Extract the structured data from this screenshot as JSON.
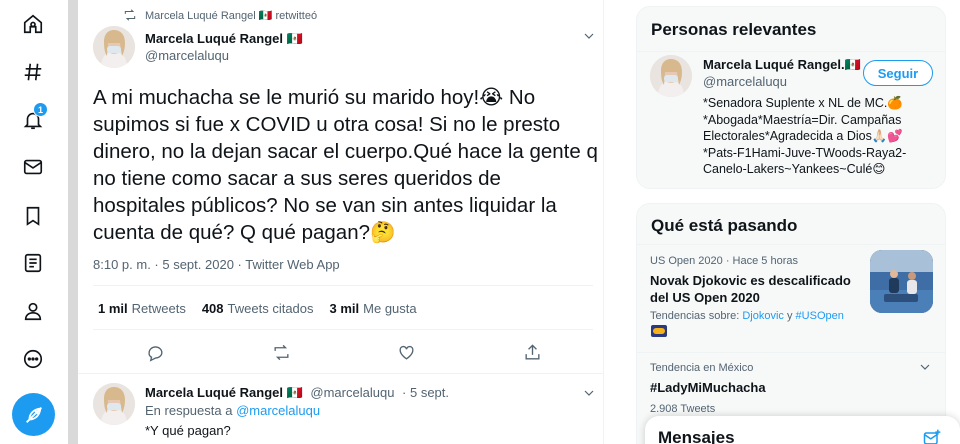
{
  "nav": {
    "items": [
      "home-icon",
      "explore-icon",
      "notifications-icon",
      "messages-icon",
      "bookmarks-icon",
      "lists-icon",
      "profile-icon",
      "more-icon"
    ],
    "notif_count": "1"
  },
  "tweet": {
    "retweeted_by": "Marcela Luqué Rangel 🇲🇽 retwitteó",
    "author_name": "Marcela Luqué Rangel 🇲🇽",
    "author_handle": "@marcelaluqu",
    "text": "A mi muchacha se le murió su marido hoy!😭 No supimos si fue x COVID u otra cosa! Si no le presto dinero, no la dejan sacar el cuerpo.Qué hace la gente q no tiene como sacar a sus seres queridos de hospitales públicos? No se van sin antes liquidar la cuenta de qué? Q qué pagan?🤔",
    "meta": "8:10 p. m. · 5 sept. 2020 · Twitter Web App",
    "retweets_count": "1 mil",
    "retweets_label": "Retweets",
    "quotes_count": "408",
    "quotes_label": "Tweets citados",
    "likes_count": "3 mil",
    "likes_label": "Me gusta"
  },
  "reply": {
    "author_name": "Marcela Luqué Rangel 🇲🇽",
    "author_handle": "@marcelaluqu",
    "time": "· 5 sept.",
    "reply_prefix": "En respuesta a",
    "reply_to": "@marcelaluqu",
    "text": "*Y qué pagan?"
  },
  "relevant": {
    "title": "Personas relevantes",
    "name": "Marcela Luqué Rangel.🇲🇽",
    "handle": "@marcelaluqu",
    "follow_label": "Seguir",
    "bio": "*Senadora Suplente x NL de MC.🍊 *Abogada*Maestría=Dir. Campañas Electorales*Agradecida a Dios🙏🏻💕 *Pats-F1Hami-Juve-TWoods-Raya2-Canelo-Lakers~Yankees~Culé😊"
  },
  "trends": {
    "title": "Qué está pasando",
    "t1_context": "US Open 2020 · Hace 5 horas",
    "t1_title": "Novak Djokovic es descalificado del US Open 2020",
    "t1_related_prefix": "Tendencias sobre:",
    "t1_related_a": "Djokovic",
    "t1_related_sep": "y",
    "t1_related_b": "#USOpen",
    "t2_context": "Tendencia en México",
    "t2_title": "#LadyMiMuchacha",
    "t2_count": "2.908 Tweets"
  },
  "messages": {
    "title": "Mensajes"
  },
  "colors": {
    "accent": "#1d9bf0",
    "text": "#0f1419",
    "muted": "#536471"
  }
}
